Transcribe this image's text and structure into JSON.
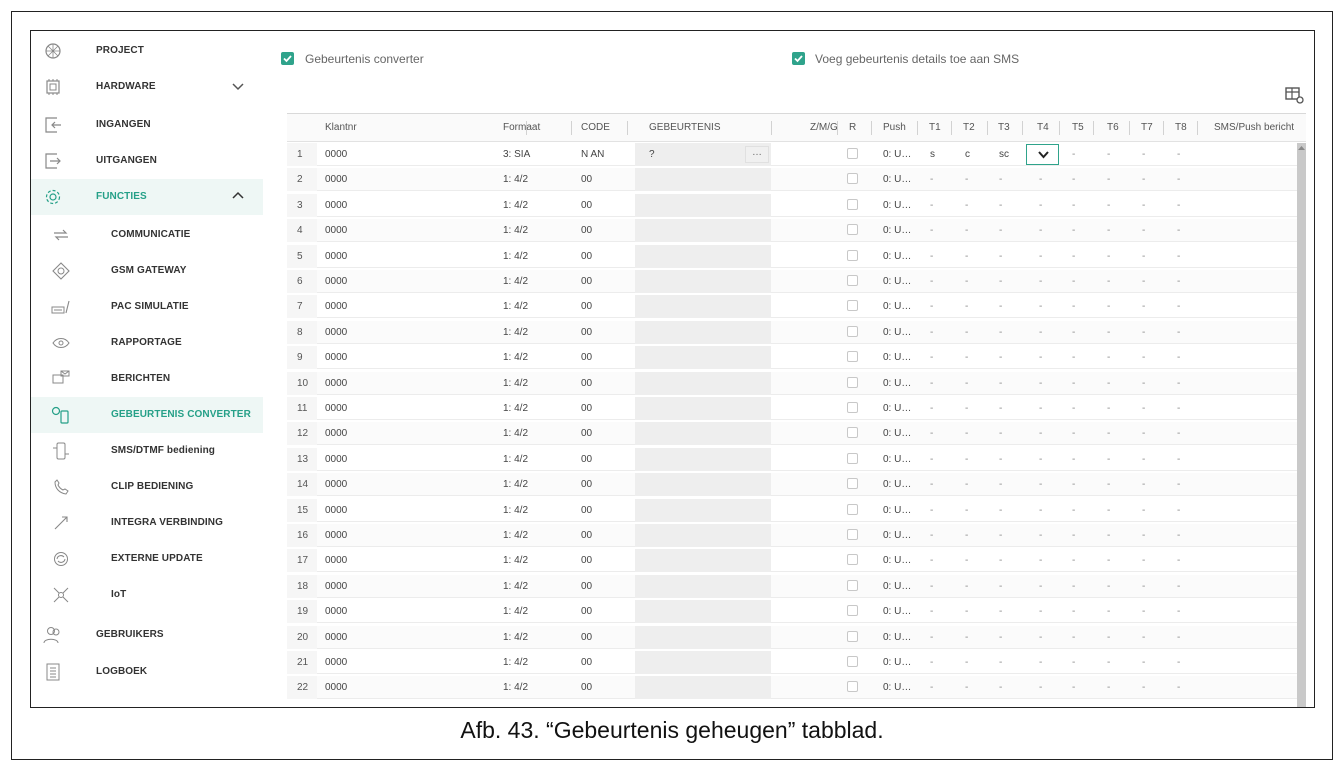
{
  "sidebar": {
    "items": [
      {
        "label": "PROJECT",
        "icon": "project-icon"
      },
      {
        "label": "HARDWARE",
        "icon": "hardware-icon"
      },
      {
        "label": "INGANGEN",
        "icon": "ingangen-icon"
      },
      {
        "label": "UITGANGEN",
        "icon": "uitgangen-icon"
      },
      {
        "label": "FUNCTIES",
        "icon": "functies-icon"
      },
      {
        "label": "COMMUNICATIE",
        "icon": "communicatie-icon"
      },
      {
        "label": "GSM GATEWAY",
        "icon": "gsm-gateway-icon"
      },
      {
        "label": "PAC SIMULATIE",
        "icon": "pac-simulatie-icon"
      },
      {
        "label": "RAPPORTAGE",
        "icon": "rapportage-icon"
      },
      {
        "label": "BERICHTEN",
        "icon": "berichten-icon"
      },
      {
        "label": "GEBEURTENIS CONVERTER",
        "icon": "gebeurtenis-converter-icon"
      },
      {
        "label": "SMS/DTMF bediening",
        "icon": "sms-dtmf-icon"
      },
      {
        "label": "CLIP BEDIENING",
        "icon": "clip-bediening-icon"
      },
      {
        "label": "INTEGRA VERBINDING",
        "icon": "integra-verbinding-icon"
      },
      {
        "label": "EXTERNE UPDATE",
        "icon": "externe-update-icon"
      },
      {
        "label": "IoT",
        "icon": "iot-icon"
      },
      {
        "label": "GEBRUIKERS",
        "icon": "gebruikers-icon"
      },
      {
        "label": "LOGBOEK",
        "icon": "logboek-icon"
      }
    ]
  },
  "options": {
    "converter_label": "Gebeurtenis converter",
    "sms_details_label": "Voeg gebeurtenis details toe aan SMS"
  },
  "table": {
    "columns": [
      "Klantnr",
      "Formaat",
      "CODE",
      "GEBEURTENIS",
      "Z/M/G",
      "R",
      "Push",
      "T1",
      "T2",
      "T3",
      "T4",
      "T5",
      "T6",
      "T7",
      "T8",
      "SMS/Push bericht"
    ],
    "rows": [
      {
        "n": "1",
        "klantnr": "0000",
        "formaat": "3: SIA",
        "code": "N AN",
        "gebeurtenis": "?",
        "push": "0: U…",
        "t": [
          "s",
          "c",
          "sc",
          "",
          "-",
          "-",
          "-",
          "-"
        ]
      },
      {
        "n": "2",
        "klantnr": "0000",
        "formaat": "1: 4/2",
        "code": "00",
        "gebeurtenis": "",
        "push": "0: U…",
        "t": [
          "-",
          "-",
          "-",
          "-",
          "-",
          "-",
          "-",
          "-"
        ]
      },
      {
        "n": "3",
        "klantnr": "0000",
        "formaat": "1: 4/2",
        "code": "00",
        "gebeurtenis": "",
        "push": "0: U…",
        "t": [
          "-",
          "-",
          "-",
          "-",
          "-",
          "-",
          "-",
          "-"
        ]
      },
      {
        "n": "4",
        "klantnr": "0000",
        "formaat": "1: 4/2",
        "code": "00",
        "gebeurtenis": "",
        "push": "0: U…",
        "t": [
          "-",
          "-",
          "-",
          "-",
          "-",
          "-",
          "-",
          "-"
        ]
      },
      {
        "n": "5",
        "klantnr": "0000",
        "formaat": "1: 4/2",
        "code": "00",
        "gebeurtenis": "",
        "push": "0: U…",
        "t": [
          "-",
          "-",
          "-",
          "-",
          "-",
          "-",
          "-",
          "-"
        ]
      },
      {
        "n": "6",
        "klantnr": "0000",
        "formaat": "1: 4/2",
        "code": "00",
        "gebeurtenis": "",
        "push": "0: U…",
        "t": [
          "-",
          "-",
          "-",
          "-",
          "-",
          "-",
          "-",
          "-"
        ]
      },
      {
        "n": "7",
        "klantnr": "0000",
        "formaat": "1: 4/2",
        "code": "00",
        "gebeurtenis": "",
        "push": "0: U…",
        "t": [
          "-",
          "-",
          "-",
          "-",
          "-",
          "-",
          "-",
          "-"
        ]
      },
      {
        "n": "8",
        "klantnr": "0000",
        "formaat": "1: 4/2",
        "code": "00",
        "gebeurtenis": "",
        "push": "0: U…",
        "t": [
          "-",
          "-",
          "-",
          "-",
          "-",
          "-",
          "-",
          "-"
        ]
      },
      {
        "n": "9",
        "klantnr": "0000",
        "formaat": "1: 4/2",
        "code": "00",
        "gebeurtenis": "",
        "push": "0: U…",
        "t": [
          "-",
          "-",
          "-",
          "-",
          "-",
          "-",
          "-",
          "-"
        ]
      },
      {
        "n": "10",
        "klantnr": "0000",
        "formaat": "1: 4/2",
        "code": "00",
        "gebeurtenis": "",
        "push": "0: U…",
        "t": [
          "-",
          "-",
          "-",
          "-",
          "-",
          "-",
          "-",
          "-"
        ]
      },
      {
        "n": "11",
        "klantnr": "0000",
        "formaat": "1: 4/2",
        "code": "00",
        "gebeurtenis": "",
        "push": "0: U…",
        "t": [
          "-",
          "-",
          "-",
          "-",
          "-",
          "-",
          "-",
          "-"
        ]
      },
      {
        "n": "12",
        "klantnr": "0000",
        "formaat": "1: 4/2",
        "code": "00",
        "gebeurtenis": "",
        "push": "0: U…",
        "t": [
          "-",
          "-",
          "-",
          "-",
          "-",
          "-",
          "-",
          "-"
        ]
      },
      {
        "n": "13",
        "klantnr": "0000",
        "formaat": "1: 4/2",
        "code": "00",
        "gebeurtenis": "",
        "push": "0: U…",
        "t": [
          "-",
          "-",
          "-",
          "-",
          "-",
          "-",
          "-",
          "-"
        ]
      },
      {
        "n": "14",
        "klantnr": "0000",
        "formaat": "1: 4/2",
        "code": "00",
        "gebeurtenis": "",
        "push": "0: U…",
        "t": [
          "-",
          "-",
          "-",
          "-",
          "-",
          "-",
          "-",
          "-"
        ]
      },
      {
        "n": "15",
        "klantnr": "0000",
        "formaat": "1: 4/2",
        "code": "00",
        "gebeurtenis": "",
        "push": "0: U…",
        "t": [
          "-",
          "-",
          "-",
          "-",
          "-",
          "-",
          "-",
          "-"
        ]
      },
      {
        "n": "16",
        "klantnr": "0000",
        "formaat": "1: 4/2",
        "code": "00",
        "gebeurtenis": "",
        "push": "0: U…",
        "t": [
          "-",
          "-",
          "-",
          "-",
          "-",
          "-",
          "-",
          "-"
        ]
      },
      {
        "n": "17",
        "klantnr": "0000",
        "formaat": "1: 4/2",
        "code": "00",
        "gebeurtenis": "",
        "push": "0: U…",
        "t": [
          "-",
          "-",
          "-",
          "-",
          "-",
          "-",
          "-",
          "-"
        ]
      },
      {
        "n": "18",
        "klantnr": "0000",
        "formaat": "1: 4/2",
        "code": "00",
        "gebeurtenis": "",
        "push": "0: U…",
        "t": [
          "-",
          "-",
          "-",
          "-",
          "-",
          "-",
          "-",
          "-"
        ]
      },
      {
        "n": "19",
        "klantnr": "0000",
        "formaat": "1: 4/2",
        "code": "00",
        "gebeurtenis": "",
        "push": "0: U…",
        "t": [
          "-",
          "-",
          "-",
          "-",
          "-",
          "-",
          "-",
          "-"
        ]
      },
      {
        "n": "20",
        "klantnr": "0000",
        "formaat": "1: 4/2",
        "code": "00",
        "gebeurtenis": "",
        "push": "0: U…",
        "t": [
          "-",
          "-",
          "-",
          "-",
          "-",
          "-",
          "-",
          "-"
        ]
      },
      {
        "n": "21",
        "klantnr": "0000",
        "formaat": "1: 4/2",
        "code": "00",
        "gebeurtenis": "",
        "push": "0: U…",
        "t": [
          "-",
          "-",
          "-",
          "-",
          "-",
          "-",
          "-",
          "-"
        ]
      },
      {
        "n": "22",
        "klantnr": "0000",
        "formaat": "1: 4/2",
        "code": "00",
        "gebeurtenis": "",
        "push": "0: U…",
        "t": [
          "-",
          "-",
          "-",
          "-",
          "-",
          "-",
          "-",
          "-"
        ]
      }
    ],
    "ellipsis": "…"
  },
  "caption": "Afb. 43. “Gebeurtenis geheugen” tabblad.",
  "colors": {
    "accent": "#2fa38b",
    "active_bg": "#eef7f5"
  }
}
